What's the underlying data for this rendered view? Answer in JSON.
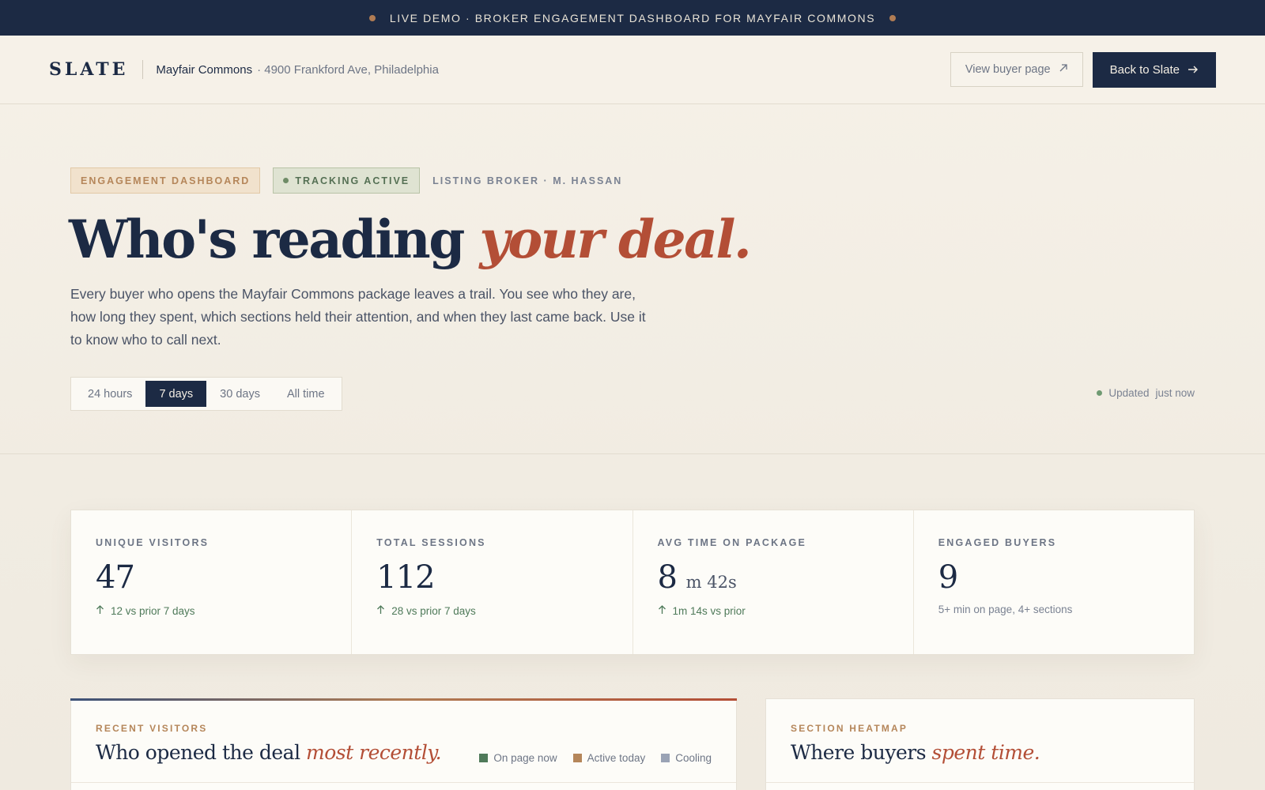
{
  "banner": {
    "text": "LIVE DEMO · BROKER ENGAGEMENT DASHBOARD FOR MAYFAIR COMMONS"
  },
  "header": {
    "logo": "SLATE",
    "property": "Mayfair Commons",
    "address": "· 4900 Frankford Ave, Philadelphia",
    "view_buyer_label": "View buyer page",
    "back_label": "Back to Slate"
  },
  "hero": {
    "tags": {
      "dashboard": "ENGAGEMENT DASHBOARD",
      "tracking": "TRACKING ACTIVE",
      "broker": "LISTING BROKER · M. HASSAN"
    },
    "headline_main": "Who's reading",
    "headline_accent": "your deal.",
    "lede": "Every buyer who opens the Mayfair Commons package leaves a trail. You see who they are, how long they spent, which sections held their attention, and when they last came back. Use it to know who to call next.",
    "ranges": [
      "24 hours",
      "7 days",
      "30 days",
      "All time"
    ],
    "active_range": "7 days",
    "updated_label": "Updated",
    "updated_value": "just now"
  },
  "stats": [
    {
      "label": "UNIQUE VISITORS",
      "value": "47",
      "unit": "",
      "delta": "12 vs prior 7 days"
    },
    {
      "label": "TOTAL SESSIONS",
      "value": "112",
      "unit": "",
      "delta": "28 vs prior 7 days"
    },
    {
      "label": "AVG TIME ON PACKAGE",
      "value": "8",
      "unit": "m 42s",
      "delta": "1m 14s vs prior"
    },
    {
      "label": "ENGAGED BUYERS",
      "value": "9",
      "unit": "",
      "note": "5+ min on page, 4+ sections"
    }
  ],
  "recent": {
    "eyebrow": "RECENT VISITORS",
    "title_main": "Who opened the deal",
    "title_accent": "most recently.",
    "legend": [
      {
        "label": "On page now",
        "color": "#4f7a5a"
      },
      {
        "label": "Active today",
        "color": "#b5865a"
      },
      {
        "label": "Cooling",
        "color": "#9aa3b5"
      }
    ]
  },
  "heatmap": {
    "eyebrow": "SECTION HEATMAP",
    "title_main": "Where buyers",
    "title_accent": "spent time."
  }
}
